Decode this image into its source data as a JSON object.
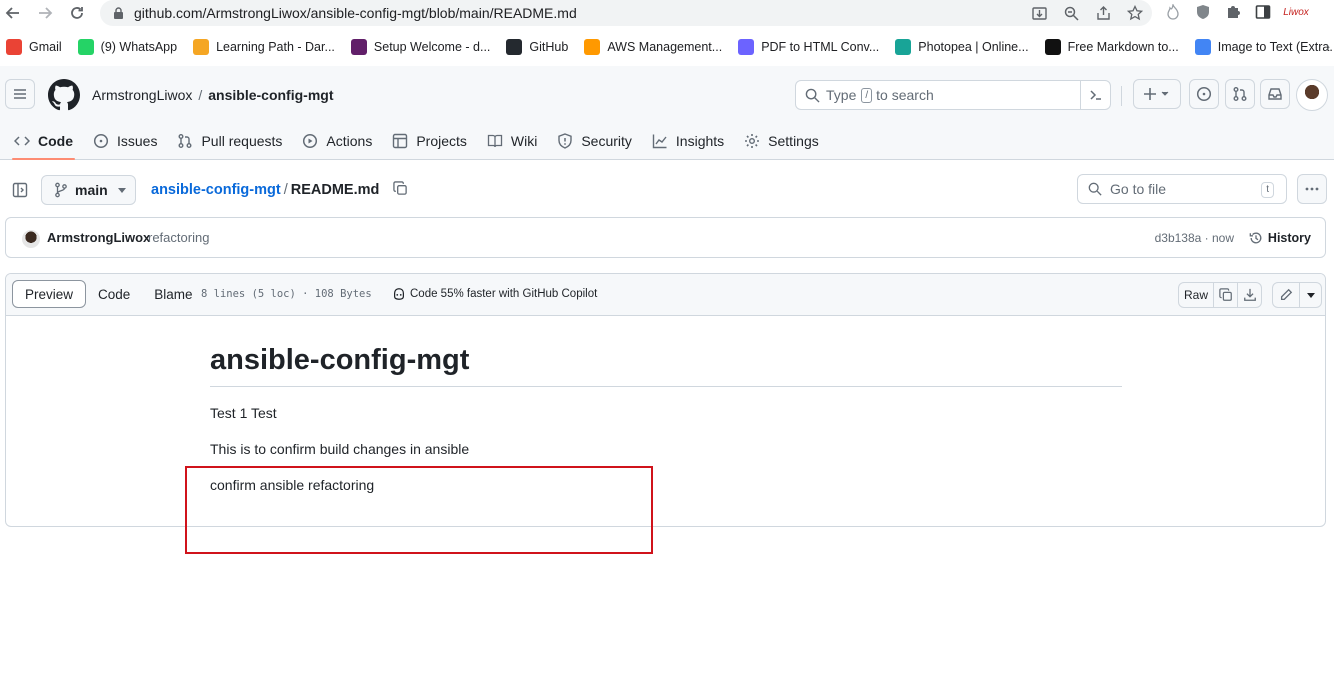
{
  "browser": {
    "url": "github.com/ArmstrongLiwox/ansible-config-mgt/blob/main/README.md",
    "profile_label": "Liwox",
    "bookmarks": [
      {
        "label": "Gmail",
        "icon": "gmail-icon",
        "color": "#ea4335"
      },
      {
        "label": "(9) WhatsApp",
        "icon": "whatsapp-icon",
        "color": "#25d366"
      },
      {
        "label": "Learning Path - Dar...",
        "icon": "darey-icon",
        "color": "#f5a623"
      },
      {
        "label": "Setup Welcome - d...",
        "icon": "slack-icon",
        "color": "#611f69"
      },
      {
        "label": "GitHub",
        "icon": "github-icon",
        "color": "#24292f"
      },
      {
        "label": "AWS Management...",
        "icon": "aws-icon",
        "color": "#ff9900"
      },
      {
        "label": "PDF to HTML Conv...",
        "icon": "pdf-icon",
        "color": "#6c63ff"
      },
      {
        "label": "Photopea | Online...",
        "icon": "photopea-icon",
        "color": "#18a497"
      },
      {
        "label": "Free Markdown to...",
        "icon": "markdown-icon",
        "color": "#111111"
      },
      {
        "label": "Image to Text (Extra...",
        "icon": "image-to-text-icon",
        "color": "#4285f4"
      }
    ]
  },
  "header": {
    "owner": "ArmstrongLiwox",
    "separator": "/",
    "repo": "ansible-config-mgt",
    "search_prefix": "Type",
    "search_key": "/",
    "search_suffix": "to search",
    "tabs": [
      {
        "label": "Code",
        "icon": "code-icon",
        "active": true
      },
      {
        "label": "Issues",
        "icon": "issue-icon"
      },
      {
        "label": "Pull requests",
        "icon": "pull-request-icon"
      },
      {
        "label": "Actions",
        "icon": "play-icon"
      },
      {
        "label": "Projects",
        "icon": "table-icon"
      },
      {
        "label": "Wiki",
        "icon": "book-icon"
      },
      {
        "label": "Security",
        "icon": "shield-icon"
      },
      {
        "label": "Insights",
        "icon": "graph-icon"
      },
      {
        "label": "Settings",
        "icon": "gear-icon"
      }
    ]
  },
  "file_nav": {
    "branch": "main",
    "repo_link": "ansible-config-mgt",
    "separator": "/",
    "file_name": "README.md",
    "goto_placeholder": "Go to file",
    "goto_key": "t"
  },
  "commit": {
    "author": "ArmstrongLiwox",
    "message": "refactoring",
    "meta": "d3b138a · now",
    "history_label": "History"
  },
  "file_toolbar": {
    "views": [
      "Preview",
      "Code",
      "Blame"
    ],
    "active_view": "Preview",
    "info": "8 lines (5 loc) · 108 Bytes",
    "copilot": "Code 55% faster with GitHub Copilot",
    "raw_label": "Raw"
  },
  "readme": {
    "title": "ansible-config-mgt",
    "paragraphs": [
      "Test 1 Test",
      "This is to confirm build changes in ansible",
      "confirm ansible refactoring"
    ]
  },
  "colors": {
    "link": "#0969da",
    "active_tab_underline": "#fd8c73",
    "annotation_box": "#d0131b"
  }
}
